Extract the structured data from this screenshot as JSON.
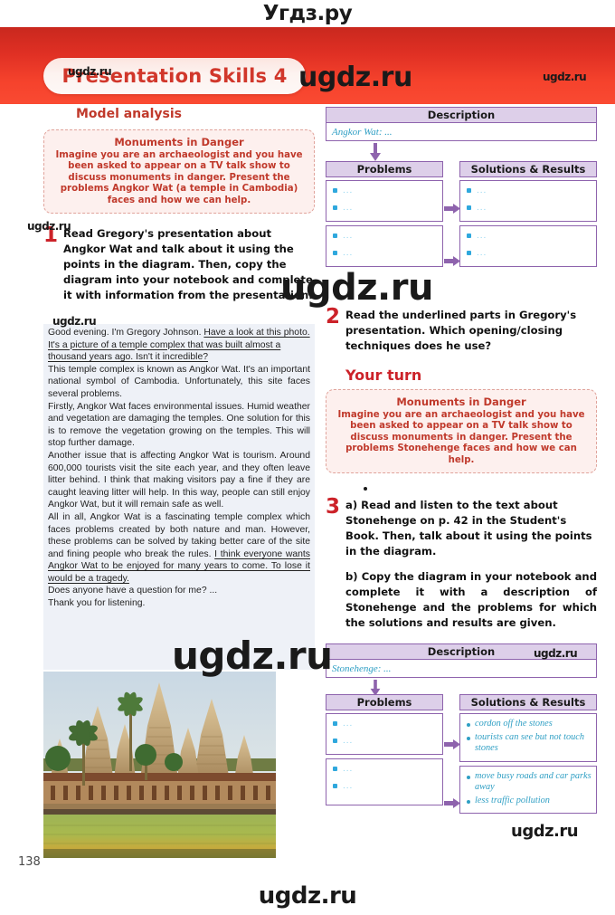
{
  "page": {
    "number": "138",
    "header_title": "Presentation Skills 4",
    "watermarks": {
      "top": "Угдз.ру",
      "brand": "ugdz.ru",
      "bottom": "ugdz.ru"
    }
  },
  "left": {
    "section_heading": "Model analysis",
    "prompt_box": {
      "title": "Monuments in Danger",
      "body": "Imagine you are an archaeologist and you have been asked to appear on a TV talk show to discuss monuments in danger. Present the problems Angkor Wat (a temple in Cambodia) faces and how we can help."
    },
    "exercise1": {
      "number": "1",
      "text": "Read Gregory's presentation about Angkor Wat and talk about it using the points in the diagram. Then, copy the diagram into your notebook and complete it with information from the presentation."
    },
    "transcript": {
      "p1_plain": "Good evening. I'm Gregory Johnson. ",
      "p1_underlined": "Have a look at this photo. It's a picture of a temple complex that was built almost a thousand years ago. Isn't it incredible?",
      "p2": "This temple complex is known as Angkor Wat. It's an important national symbol of Cambodia. Unfortunately, this site faces several problems.",
      "p3": "Firstly, Angkor Wat faces environmental issues. Humid weather and vegetation are damaging the temples. One solution for this is to remove the vegetation growing on the temples. This will stop further damage.",
      "p4": "Another issue that is affecting Angkor Wat is tourism. Around 600,000 tourists visit the site each year, and they often leave litter behind. I think that making visitors pay a fine if they are caught leaving litter will help. In this way, people can still enjoy Angkor Wat, but it will remain safe as well.",
      "p5_plain": "All in all, Angkor Wat is a fascinating temple complex which faces problems created by both nature and man. However, these problems can be solved by taking better care of the site and fining people who break the rules. ",
      "p5_underlined": "I think everyone wants Angkor Wat to be enjoyed for many years to come. To lose it would be a tragedy.",
      "p6": "Does anyone have a question for me? ...",
      "p7": "Thank you for listening."
    },
    "photo_alt": "angkor-wat-temple-photo"
  },
  "right": {
    "diagram_top": {
      "description_label": "Description",
      "description_value": "Angkor Wat: ...",
      "problems_label": "Problems",
      "solutions_label": "Solutions & Results",
      "problem_cells": [
        {
          "bullets": [
            "...",
            "..."
          ]
        },
        {
          "bullets": [
            "...",
            "..."
          ]
        }
      ],
      "solution_cells": [
        {
          "bullets": [
            "...",
            "..."
          ]
        },
        {
          "bullets": [
            "...",
            "..."
          ]
        }
      ]
    },
    "exercise2": {
      "number": "2",
      "text": "Read the underlined parts in Gregory's presentation. Which opening/closing techniques does he use?"
    },
    "your_turn_heading": "Your turn",
    "prompt_box": {
      "title": "Monuments in Danger",
      "body": "Imagine you are an archaeologist and you have been asked to appear on a TV talk show to discuss monuments in danger. Present the problems Stonehenge faces and how we can help."
    },
    "exercise3": {
      "number": "3",
      "part_a": "a)  Read and listen to the text about Stonehenge on p. 42 in the Student's Book. Then, talk about it using the points in the diagram.",
      "part_b": "b) Copy the diagram in your notebook and complete it with a description of Stonehenge and the problems for which the solutions and results are given."
    },
    "diagram_bottom": {
      "description_label": "Description",
      "description_value": "Stonehenge: ...",
      "problems_label": "Problems",
      "solutions_label": "Solutions & Results",
      "problem_cells": [
        {
          "bullets": [
            "...",
            "..."
          ]
        },
        {
          "bullets": [
            "...",
            "..."
          ]
        }
      ],
      "solution_cells": [
        {
          "bullets": [
            "cordon off the stones",
            "tourists can see but not touch stones"
          ]
        },
        {
          "bullets": [
            "move busy roads and car parks away",
            "less traffic pollution"
          ]
        }
      ]
    }
  },
  "colors": {
    "header_red": "#e03024",
    "accent_red": "#cc2229",
    "diagram_purple": "#8e63ad",
    "diagram_band": "#ddcfe9",
    "diagram_text_teal": "#2f9fc4",
    "transcript_bg": "#eef1f7"
  }
}
